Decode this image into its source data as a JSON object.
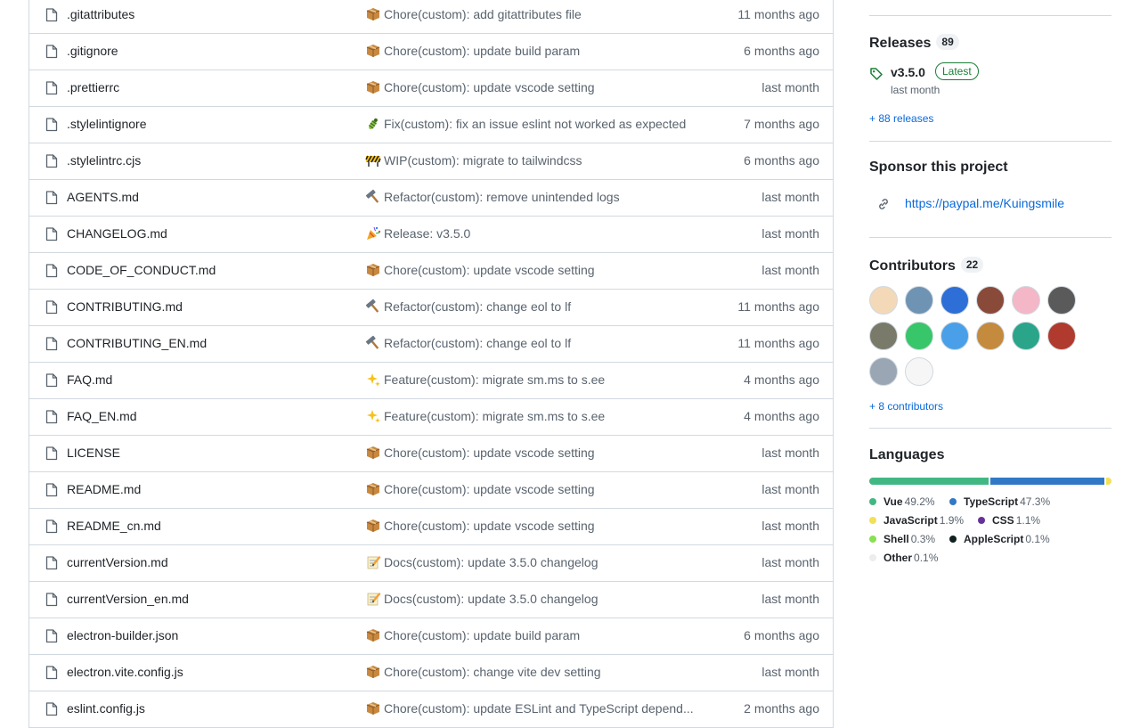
{
  "files": [
    {
      "name": ".gitattributes",
      "emoji": "package",
      "message": "Chore(custom): add gitattributes file",
      "date": "11 months ago"
    },
    {
      "name": ".gitignore",
      "emoji": "package",
      "message": "Chore(custom): update build param",
      "date": "6 months ago"
    },
    {
      "name": ".prettierrc",
      "emoji": "package",
      "message": "Chore(custom): update vscode setting",
      "date": "last month"
    },
    {
      "name": ".stylelintignore",
      "emoji": "bug",
      "message": "Fix(custom): fix an issue eslint not worked as expected",
      "date": "7 months ago"
    },
    {
      "name": ".stylelintrc.cjs",
      "emoji": "construction",
      "message": "WIP(custom): migrate to tailwindcss",
      "date": "6 months ago"
    },
    {
      "name": "AGENTS.md",
      "emoji": "hammer",
      "message": "Refactor(custom): remove unintended logs",
      "date": "last month"
    },
    {
      "name": "CHANGELOG.md",
      "emoji": "tada",
      "message": "Release: v3.5.0",
      "date": "last month"
    },
    {
      "name": "CODE_OF_CONDUCT.md",
      "emoji": "package",
      "message": "Chore(custom): update vscode setting",
      "date": "last month"
    },
    {
      "name": "CONTRIBUTING.md",
      "emoji": "hammer",
      "message": "Refactor(custom): change eol to lf",
      "date": "11 months ago"
    },
    {
      "name": "CONTRIBUTING_EN.md",
      "emoji": "hammer",
      "message": "Refactor(custom): change eol to lf",
      "date": "11 months ago"
    },
    {
      "name": "FAQ.md",
      "emoji": "sparkles",
      "message": "Feature(custom): migrate sm.ms to s.ee",
      "date": "4 months ago"
    },
    {
      "name": "FAQ_EN.md",
      "emoji": "sparkles",
      "message": "Feature(custom): migrate sm.ms to s.ee",
      "date": "4 months ago"
    },
    {
      "name": "LICENSE",
      "emoji": "package",
      "message": "Chore(custom): update vscode setting",
      "date": "last month"
    },
    {
      "name": "README.md",
      "emoji": "package",
      "message": "Chore(custom): update vscode setting",
      "date": "last month"
    },
    {
      "name": "README_cn.md",
      "emoji": "package",
      "message": "Chore(custom): update vscode setting",
      "date": "last month"
    },
    {
      "name": "currentVersion.md",
      "emoji": "memo",
      "message": "Docs(custom): update 3.5.0 changelog",
      "date": "last month"
    },
    {
      "name": "currentVersion_en.md",
      "emoji": "memo",
      "message": "Docs(custom): update 3.5.0 changelog",
      "date": "last month"
    },
    {
      "name": "electron-builder.json",
      "emoji": "package",
      "message": "Chore(custom): update build param",
      "date": "6 months ago"
    },
    {
      "name": "electron.vite.config.js",
      "emoji": "package",
      "message": "Chore(custom): change vite dev setting",
      "date": "last month"
    },
    {
      "name": "eslint.config.js",
      "emoji": "package",
      "message": "Chore(custom): update ESLint and TypeScript depend...",
      "date": "2 months ago"
    }
  ],
  "releases": {
    "title": "Releases",
    "count": "89",
    "latest_version": "v3.5.0",
    "latest_badge": "Latest",
    "latest_date": "last month",
    "more_link": "+ 88 releases"
  },
  "sponsor": {
    "title": "Sponsor this project",
    "link": "https://paypal.me/Kuingsmile"
  },
  "contributors": {
    "title": "Contributors",
    "count": "22",
    "more_link": "+ 8 contributors",
    "avatars": [
      "#f3d9b8",
      "#6f93b3",
      "#2d6fd6",
      "#8a4a3a",
      "#f3b7c8",
      "#5a5a5a",
      "#7a7a6a",
      "#38c66a",
      "#4aa0e8",
      "#c48a3e",
      "#2aa58a",
      "#b03a2e",
      "#9aa6b4",
      "#f6f6f6"
    ]
  },
  "languages": {
    "title": "Languages",
    "items": [
      {
        "name": "Vue",
        "pct": "49.2%",
        "value": 49.2,
        "color": "#41b883"
      },
      {
        "name": "TypeScript",
        "pct": "47.3%",
        "value": 47.3,
        "color": "#3178c6"
      },
      {
        "name": "JavaScript",
        "pct": "1.9%",
        "value": 1.9,
        "color": "#f1e05a"
      },
      {
        "name": "CSS",
        "pct": "1.1%",
        "value": 1.1,
        "color": "#663399"
      },
      {
        "name": "Shell",
        "pct": "0.3%",
        "value": 0.3,
        "color": "#89e051"
      },
      {
        "name": "AppleScript",
        "pct": "0.1%",
        "value": 0.1,
        "color": "#101f1f"
      },
      {
        "name": "Other",
        "pct": "0.1%",
        "value": 0.1,
        "color": "#ededed"
      }
    ]
  }
}
